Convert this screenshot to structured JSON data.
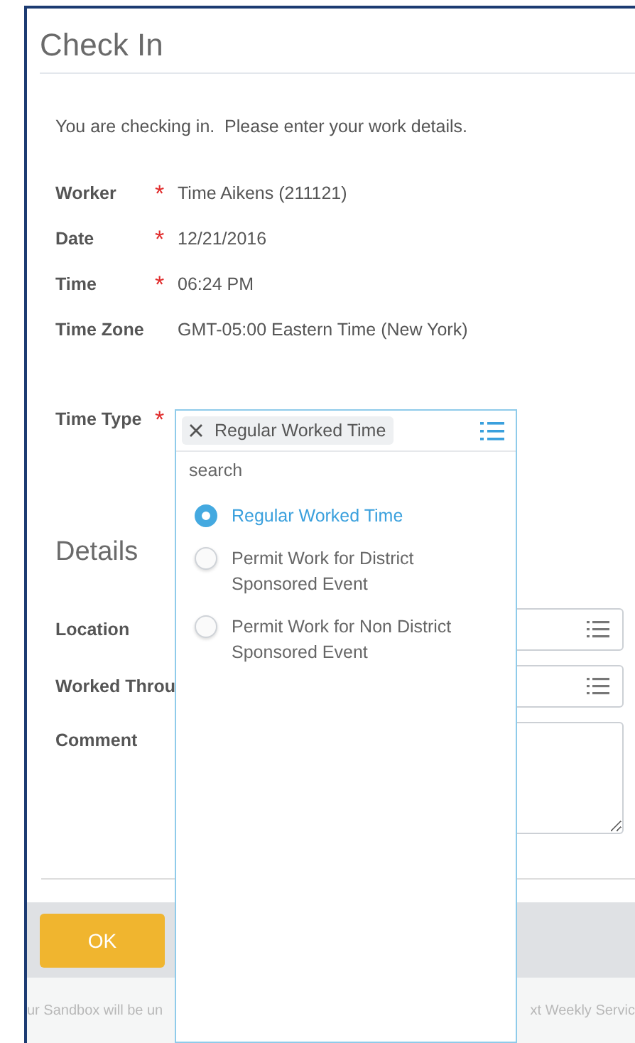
{
  "title": "Check In",
  "required_mark": "*",
  "intro": "You are checking in.  Please enter your work details.",
  "fields": [
    {
      "label": "Worker",
      "required": true,
      "value": "Time Aikens (211121)"
    },
    {
      "label": "Date",
      "required": true,
      "value": "12/21/2016"
    },
    {
      "label": "Time",
      "required": true,
      "value": "06:24 PM"
    },
    {
      "label": "Time Zone",
      "required": false,
      "value": "GMT-05:00 Eastern Time (New York)"
    }
  ],
  "time_type": {
    "label": "Time Type",
    "required": true,
    "chip": "Regular Worked Time",
    "placeholder": "search",
    "options": [
      {
        "label": "Regular Worked Time",
        "selected": true
      },
      {
        "label": "Permit Work for District Sponsored Event",
        "selected": false
      },
      {
        "label": "Permit Work for Non District Sponsored Event",
        "selected": false
      }
    ]
  },
  "details": {
    "heading": "Details",
    "fields": [
      {
        "label": "Location",
        "kind": "prompt"
      },
      {
        "label": "Worked Throu",
        "kind": "prompt"
      },
      {
        "label": "Comment",
        "kind": "textarea"
      }
    ]
  },
  "ok_button": "OK",
  "notice": [
    "ur Sandbox will be un",
    "xt Weekly Servic"
  ]
}
